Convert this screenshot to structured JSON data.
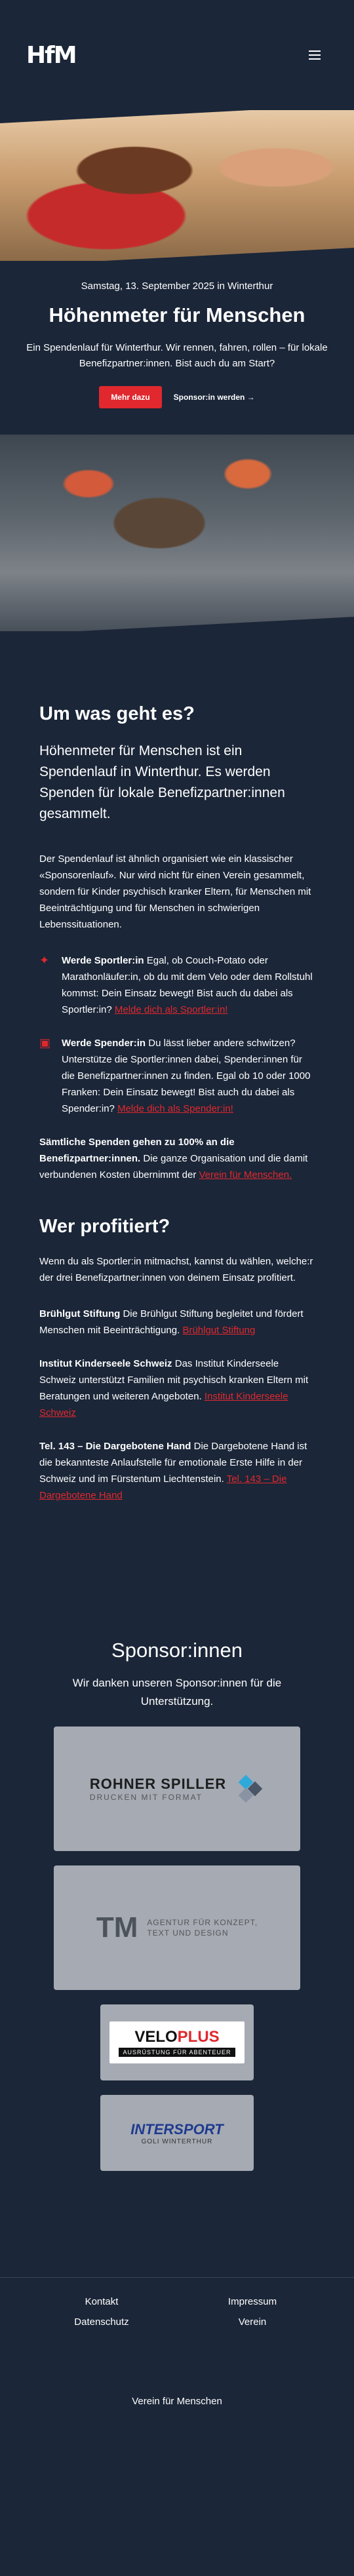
{
  "header": {
    "logo_text": "HfM",
    "menu_icon": "hamburger-icon"
  },
  "hero": {
    "date": "Samstag, 13. September 2025 in Winterthur",
    "title": "Höhenmeter für Menschen",
    "text": "Ein Spendenlauf für Winterthur. Wir rennen, fahren, rollen – für lokale Benefizpartner:innen. Bist auch du am Start?",
    "primary_label": "Mehr dazu",
    "secondary_label": "Sponsor:in werden →"
  },
  "about": {
    "title": "Um was geht es?",
    "lead": "Höhenmeter für Menschen ist ein Spendenlauf in Winterthur. Es werden Spenden für lokale Benefizpartner:innen gesammelt.",
    "text": "Der Spendenlauf ist ähnlich organisiert wie ein klassischer «Sponsorenlauf». Nur wird nicht für einen Verein gesammelt, sondern für Kinder psychisch kranker Eltern, für Menschen mit Beeinträchtigung und für Menschen in schwierigen Lebenssituationen.",
    "features": [
      {
        "icon": "sparkle-icon",
        "bold": "Werde Sportler:in",
        "text": " Egal, ob Couch-Potato oder Marathonläufer:in, ob du mit dem Velo oder dem Rollstuhl kommst: Dein Einsatz bewegt! Bist auch du dabei als Sportler:in? ",
        "link": "Melde dich als Sportler:in!"
      },
      {
        "icon": "money-icon",
        "bold": "Werde Spender:in",
        "text": " Du lässt lieber andere schwitzen? Unterstütze die Sportler:innen dabei, Spender:innen für die Benefizpartner:innen zu finden. Egal ob 10 oder 1000 Franken: Dein Einsatz bewegt! Bist auch du dabei als Spender:in? ",
        "link": "Melde dich als Spender:in!"
      }
    ],
    "donation_bold": "Sämtliche Spenden gehen zu 100% an die Benefizpartner:innen.",
    "donation_text": " Die ganze Organisation und die damit verbundenen Kosten übernimmt der ",
    "donation_link": "Verein für Menschen."
  },
  "beneficiaries": {
    "title": "Wer profitiert?",
    "intro": "Wenn du als Sportler:in mitmachst, kannst du wählen, welche:r der drei Benefizpartner:innen von deinem Einsatz profitiert.",
    "orgs": [
      {
        "name": "Brühlgut Stiftung",
        "text": " Die Brühlgut Stiftung begleitet und fördert Menschen mit Beeinträchtigung. ",
        "link": "Brühlgut Stiftung"
      },
      {
        "name": "Institut Kinderseele Schweiz",
        "text": " Das Institut Kinderseele Schweiz unterstützt Familien mit psychisch kranken Eltern mit Beratungen und weiteren Angeboten. ",
        "link": "Institut Kinderseele Schweiz"
      },
      {
        "name": "Tel. 143 – Die Dargebotene Hand",
        "text": " Die Dargebotene Hand ist die bekannteste Anlaufstelle für emotionale Erste Hilfe in der Schweiz und im Fürstentum Liechtenstein. ",
        "link": "Tel. 143 – Die Dargebotene Hand"
      }
    ]
  },
  "sponsors": {
    "title": "Sponsor:innen",
    "subtitle": "Wir danken unseren Sponsor:innen für die Unterstützung.",
    "rohner": {
      "name": "ROHNER SPILLER",
      "tagline": "DRUCKEN MIT FORMAT"
    },
    "tm": {
      "mark": "TM",
      "line1": "AGENTUR FÜR KONZEPT,",
      "line2": "TEXT UND DESIGN"
    },
    "velo": {
      "name_a": "VELO",
      "name_b": "PLUS",
      "tagline": "AUSRÜSTUNG FÜR ABENTEUER"
    },
    "intersport": {
      "name": "INTERSPORT",
      "tagline": "GOLI WINTERTHUR"
    }
  },
  "footer": {
    "links": [
      "Kontakt",
      "Impressum",
      "Datenschutz",
      "Verein"
    ],
    "bottom": "Verein für Menschen"
  },
  "colors": {
    "background": "#1b2638",
    "accent": "#e0282e"
  }
}
